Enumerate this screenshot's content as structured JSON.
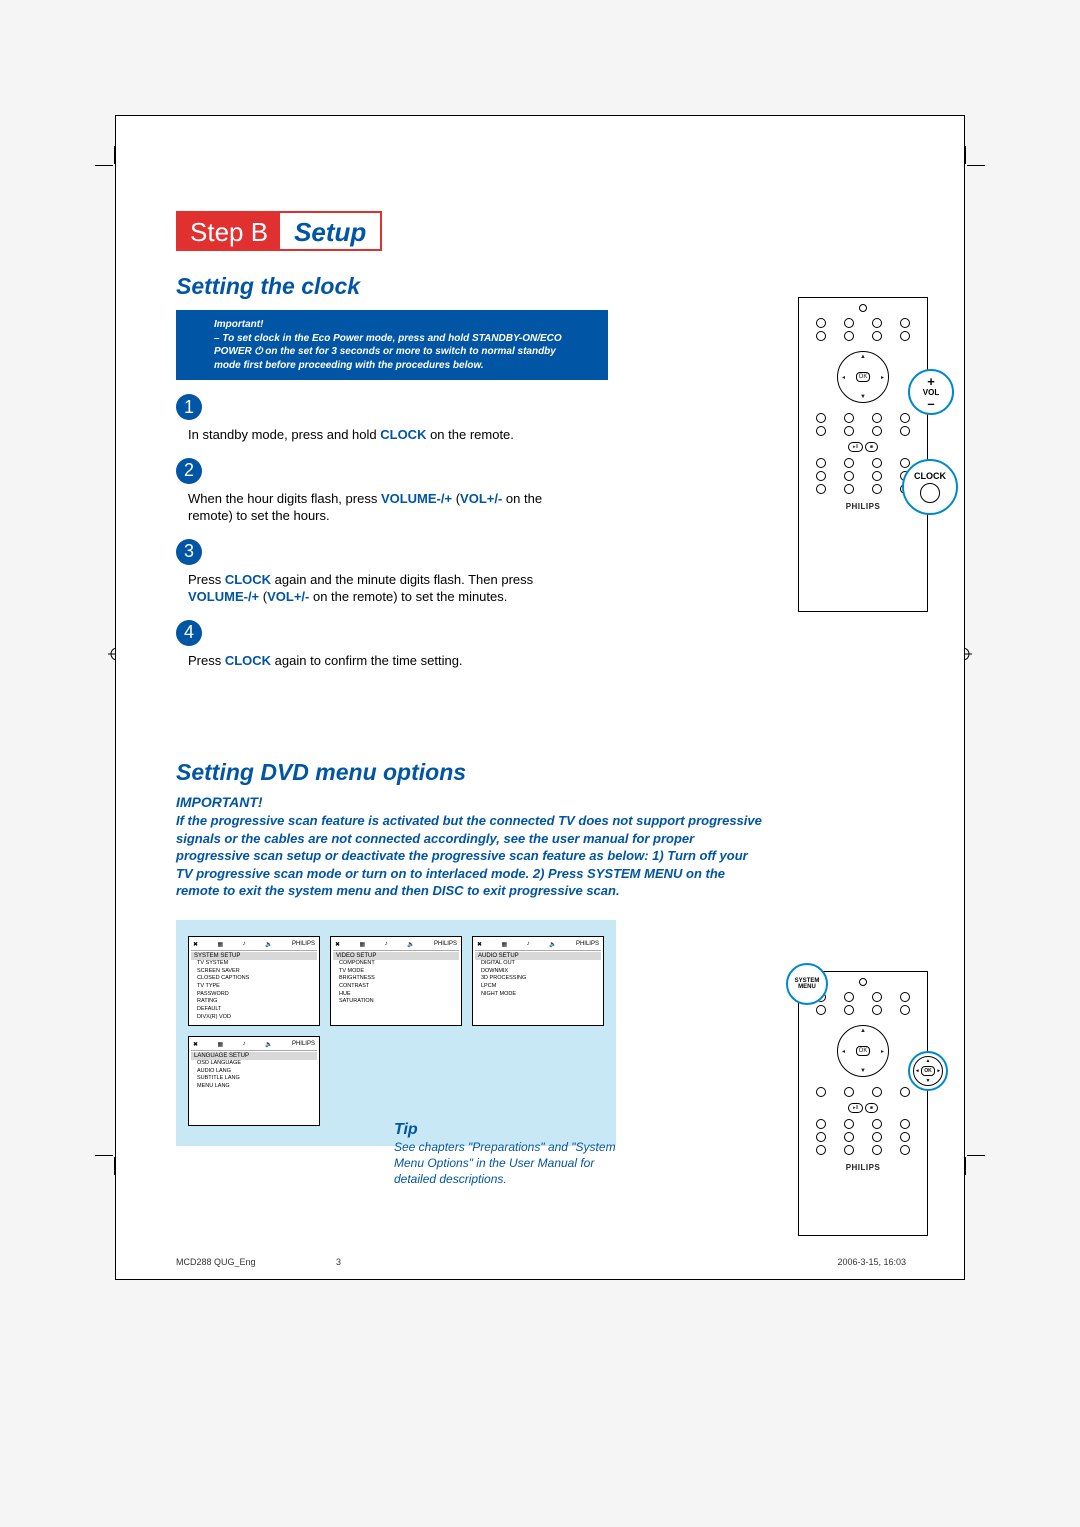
{
  "header": {
    "step": "Step B",
    "setup": "Setup"
  },
  "section1_title": "Setting the clock",
  "important_box": {
    "label": "Important!",
    "body": "– To set clock in the Eco Power mode, press and hold STANDBY-ON/ECO POWER ⏻ on the set for 3 seconds or more to switch to normal standby mode first before proceeding with the procedures below."
  },
  "steps": [
    {
      "n": "1",
      "pre": "In standby mode, press and hold ",
      "kw": "CLOCK",
      "post": " on the remote."
    },
    {
      "n": "2",
      "pre": "When the hour digits flash, press ",
      "kw": "VOLUME-/+",
      "mid": " (",
      "kw2": "VOL+/-",
      "post": " on the remote) to set the hours."
    },
    {
      "n": "3",
      "pre": "Press ",
      "kw": "CLOCK",
      "mid": " again and the minute digits flash. Then press ",
      "kw2": "VOLUME-/+",
      "mid2": " (",
      "kw3": "VOL+/-",
      "post": " on the remote) to set the minutes."
    },
    {
      "n": "4",
      "pre": "Press ",
      "kw": "CLOCK",
      "post": " again to confirm the time setting."
    }
  ],
  "callouts": {
    "vol": {
      "plus": "+",
      "label": "VOL",
      "minus": "–"
    },
    "clock_label": "CLOCK",
    "sysmenu": "SYSTEM MENU",
    "ok": "OK",
    "brand": "PHILIPS"
  },
  "section2_title": "Setting DVD menu options",
  "important2_label": "IMPORTANT!",
  "important2_body": "If the progressive scan feature is activated but the connected TV does not support progressive signals or the cables are not connected accordingly, see the user manual for proper progressive scan setup or deactivate the progressive scan feature as below:\n1) Turn off your TV progressive scan mode or turn on to interlaced mode.\n2) Press SYSTEM MENU on the remote to exit the system menu and then DISC to exit progressive scan.",
  "menus": {
    "screens": [
      {
        "title": "SYSTEM SETUP",
        "items": [
          "TV SYSTEM",
          "SCREEN SAVER",
          "CLOSED CAPTIONS",
          "TV TYPE",
          "PASSWORD",
          "RATING",
          "DEFAULT",
          "DIVX(R) VOD"
        ]
      },
      {
        "title": "VIDEO SETUP",
        "items": [
          "COMPONENT",
          "TV MODE",
          "BRIGHTNESS",
          "CONTRAST",
          "HUE",
          "SATURATION"
        ]
      },
      {
        "title": "AUDIO SETUP",
        "items": [
          "DIGITAL OUT",
          "DOWNMIX",
          "3D PROCESSING",
          "LPCM",
          "NIGHT MODE"
        ]
      },
      {
        "title": "LANGUAGE SETUP",
        "items": [
          "OSD LANGUAGE",
          "AUDIO LANG",
          "SUBTITLE LANG",
          "MENU LANG"
        ]
      }
    ],
    "iconbar_brand": "PHILIPS"
  },
  "tip": {
    "title": "Tip",
    "body": "See chapters \"Preparations\" and \"System Menu Options\" in the User Manual for detailed descriptions."
  },
  "footer": {
    "doc": "MCD288 QUG_Eng",
    "page": "3",
    "date": "2006-3-15, 16:03"
  },
  "colors": {
    "brand_red": "#e03030",
    "brand_blue": "#0055a5",
    "callout_blue": "#0088cc",
    "panel": "#c8e8f5"
  }
}
